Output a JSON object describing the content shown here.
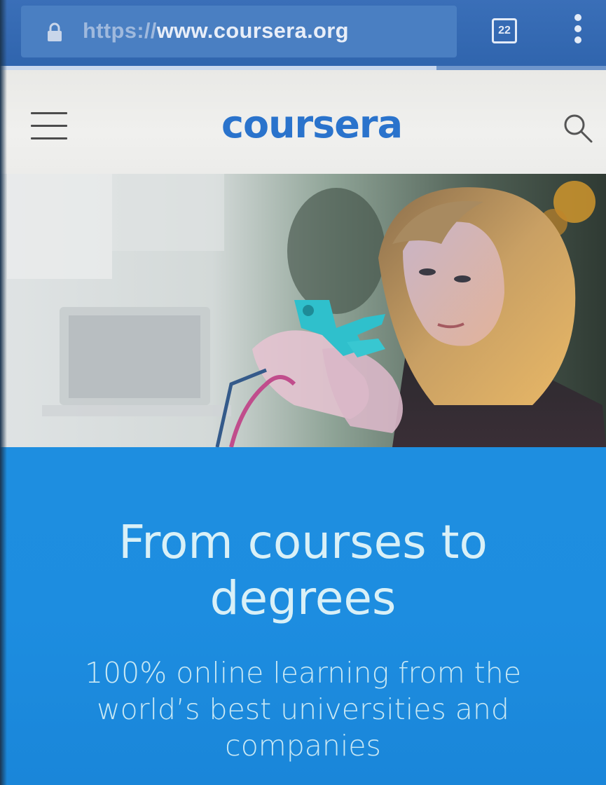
{
  "browser": {
    "url_scheme": "https://",
    "url_host": "www.coursera.org",
    "tab_count": "22",
    "load_progress": 0.72,
    "icons": [
      "lock-icon",
      "tabs-icon",
      "more-vert-icon"
    ]
  },
  "site_header": {
    "logo_text": "coursera",
    "brand_color": "#2a73cc",
    "icons": [
      "hamburger-menu-icon",
      "search-icon"
    ]
  },
  "hero": {
    "image_alt": "Woman examining a blue robotic part",
    "headline": "From courses to degrees",
    "subheadline": "100% online learning from the world’s best universities and companies",
    "background_color": "#1e8ee0"
  }
}
